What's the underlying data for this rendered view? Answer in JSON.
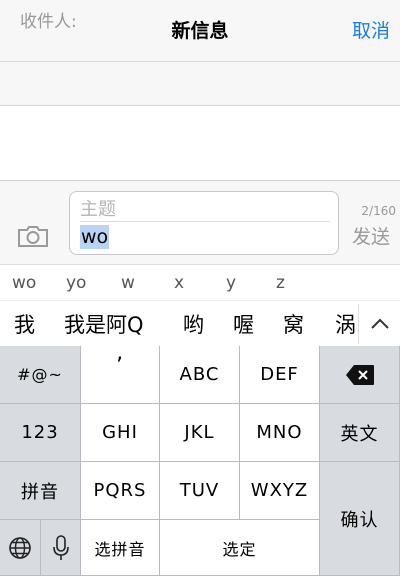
{
  "navbar": {
    "title": "新信息",
    "cancel": "取消"
  },
  "recipient": {
    "label": "收件人:"
  },
  "compose": {
    "subject_placeholder": "主题",
    "typed_text": "wo",
    "char_count": "2/160",
    "send_label": "发送"
  },
  "pinyin_options": [
    "wo",
    "yo",
    "w",
    "x",
    "y",
    "z"
  ],
  "candidates": [
    "我",
    "我是阿Q",
    "哟",
    "喔",
    "窝",
    "涡"
  ],
  "keyboard": {
    "symbols": "#@~",
    "punct": "’",
    "abc": "ABC",
    "def": "DEF",
    "num": "123",
    "ghi": "GHI",
    "jkl": "JKL",
    "mno": "MNO",
    "english": "英文",
    "pinyin": "拼音",
    "pqrs": "PQRS",
    "tuv": "TUV",
    "wxyz": "WXYZ",
    "confirm": "确认",
    "select_pinyin": "选拼音",
    "select": "选定"
  },
  "icons": [
    "camera-icon",
    "chevron-up-icon",
    "delete-icon",
    "globe-icon",
    "mic-icon"
  ],
  "colors": {
    "accent": "#1a7cf5",
    "selection": "#b8d3f3"
  }
}
